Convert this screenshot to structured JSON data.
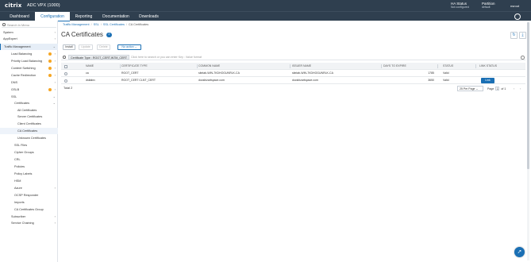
{
  "header": {
    "brand": "citrix",
    "product": "ADC VPX (1000)",
    "ha_status_label": "HA Status",
    "ha_status_value": "Not configured",
    "partition_label": "Partition",
    "partition_value": "default",
    "user": "nsroot"
  },
  "nav": {
    "tabs": [
      "Dashboard",
      "Configuration",
      "Reporting",
      "Documentation",
      "Downloads"
    ],
    "active": "Configuration"
  },
  "sidebar": {
    "search_placeholder": "Search in Menu",
    "items": [
      {
        "label": "System"
      },
      {
        "label": "AppExpert"
      },
      {
        "label": "Traffic Management"
      },
      {
        "label": "Load Balancing"
      },
      {
        "label": "Priority Load Balancing"
      },
      {
        "label": "Content Switching"
      },
      {
        "label": "Cache Redirection"
      },
      {
        "label": "DNS"
      },
      {
        "label": "GSLB"
      },
      {
        "label": "SSL"
      },
      {
        "label": "Certificates"
      },
      {
        "label": "All Certificates"
      },
      {
        "label": "Server Certificates"
      },
      {
        "label": "Client Certificates"
      },
      {
        "label": "CA Certificates"
      },
      {
        "label": "Unknown Certificates"
      },
      {
        "label": "SSL Files"
      },
      {
        "label": "Cipher Groups"
      },
      {
        "label": "CRL"
      },
      {
        "label": "Policies"
      },
      {
        "label": "Policy Labels"
      },
      {
        "label": "HSM"
      },
      {
        "label": "Azure"
      },
      {
        "label": "OCSP Responder"
      },
      {
        "label": "Imports"
      },
      {
        "label": "CA Certificates Group"
      },
      {
        "label": "Subscriber"
      },
      {
        "label": "Service Chaining"
      }
    ]
  },
  "breadcrumb": [
    "Traffic Management",
    "SSL",
    "SSL Certificates",
    "CA Certificates"
  ],
  "page": {
    "title": "CA Certificates",
    "count": "2"
  },
  "toolbar": {
    "install": "Install",
    "update": "Update",
    "delete": "Delete",
    "no_action": "No action"
  },
  "filter": {
    "chip": "Certificate Type : ROOT_CERT,INTM_CERT",
    "hint": "Click here to search or you can enter Key : Value format"
  },
  "table": {
    "columns": [
      "NAME",
      "CERTIFICATE TYPE",
      "COMMON NAME",
      "ISSUER NAME",
      "DAYS TO EXPIRE",
      "STATUS",
      "LINK STATUS"
    ],
    "rows": [
      {
        "name": "ca",
        "type": "ROOT_CERT",
        "common": "sitelab-WIN-7KDHOGUNRLK-CA",
        "issuer": "sitelab-WIN-7KDHOGUNRLK-CA",
        "days": "1785",
        "status": "Valid",
        "link": ""
      },
      {
        "name": "dstlabro",
        "type": "ROOT_CERT CLNT_CERT",
        "common": "docsbizartspace.com",
        "issuer": "docsbizartspace.com",
        "days": "3650",
        "status": "Valid",
        "link": "Link"
      }
    ]
  },
  "pagination": {
    "total": "Total 2",
    "per_page": "25 Per Page",
    "page_label": "Page",
    "page_value": "1",
    "of_label": "of 1"
  }
}
